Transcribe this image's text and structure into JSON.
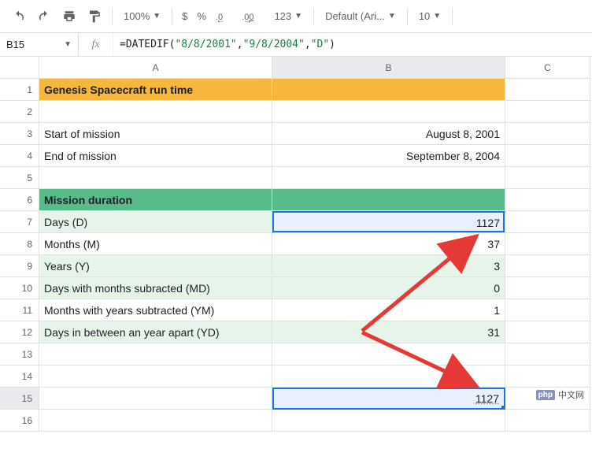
{
  "toolbar": {
    "zoom": "100%",
    "currency": "$",
    "percent": "%",
    "dec_dec": ".0",
    "dec_inc": ".00",
    "123": "123",
    "font": "Default (Ari...",
    "font_size": "10"
  },
  "formula_bar": {
    "cell_ref": "B15",
    "fx": "fx",
    "eq": "=",
    "fn": "DATEDIF",
    "open": "(",
    "arg1": "\"8/8/2001\"",
    "c1": ",",
    "arg2": "\"9/8/2004\"",
    "c2": ",",
    "arg3": "\"D\"",
    "close": ")"
  },
  "columns": [
    "A",
    "B",
    "C"
  ],
  "rows": [
    "1",
    "2",
    "3",
    "4",
    "5",
    "6",
    "7",
    "8",
    "9",
    "10",
    "11",
    "12",
    "13",
    "14",
    "15",
    "16"
  ],
  "cells": {
    "A1": "Genesis Spacecraft run time",
    "A3": "Start of mission",
    "B3": "August 8, 2001",
    "A4": "End of mission",
    "B4": "September 8, 2004",
    "A6": "Mission duration",
    "A7": "Days (D)",
    "B7": "1127",
    "A8": "Months (M)",
    "B8": "37",
    "A9": "Years (Y)",
    "B9": "3",
    "A10": "Days with months subracted (MD)",
    "B10": "0",
    "A11": "Months with years subtracted (YM)",
    "B11": "1",
    "A12": "Days in between an year apart (YD)",
    "B12": "31",
    "B15": "1127"
  },
  "watermark": {
    "php": "php",
    "text": "中文网"
  }
}
